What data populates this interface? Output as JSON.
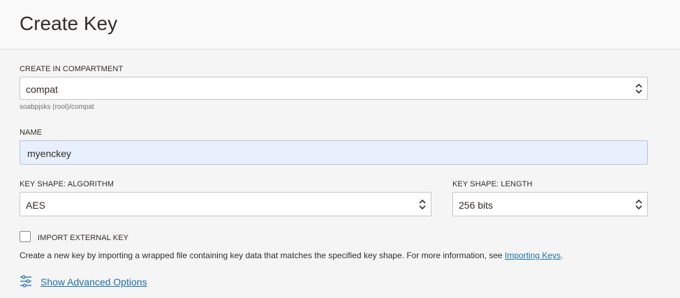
{
  "header": {
    "title": "Create Key"
  },
  "compartment": {
    "label": "CREATE IN COMPARTMENT",
    "value": "compat",
    "path": "soabpjsks (root)/compat"
  },
  "name": {
    "label": "NAME",
    "value": "myenckey"
  },
  "algorithm": {
    "label": "KEY SHAPE: ALGORITHM",
    "value": "AES"
  },
  "length": {
    "label": "KEY SHAPE: LENGTH",
    "value": "256 bits"
  },
  "import": {
    "label": "IMPORT EXTERNAL KEY",
    "checked": false,
    "description": "Create a new key by importing a wrapped file containing key data that matches the specified key shape. For more information, see",
    "link_text": "Importing Keys",
    "suffix": "."
  },
  "advanced": {
    "link_text": "Show Advanced Options",
    "icon": "sliders-icon"
  },
  "colors": {
    "link": "#1e6fa8",
    "autofill_bg": "#e8f0fe"
  }
}
